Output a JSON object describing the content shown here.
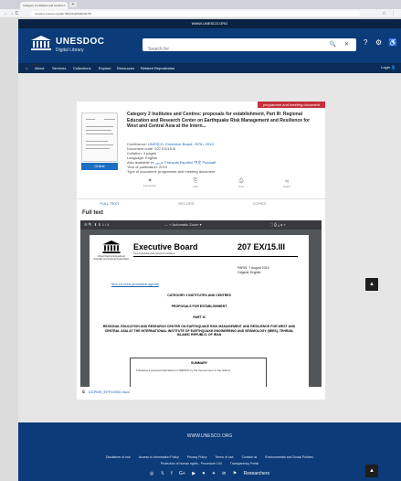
{
  "browser": {
    "tab_title": "Category 2 institutes and Centres",
    "tab_close": "×",
    "new_tab": "+",
    "nav_icons": "← → C",
    "url": "unesdoc.unesco.org/ark:/48223/pf0000230781",
    "right_icons": "☆ ⋮"
  },
  "site": {
    "top_strip": "WWW.UNESCO.ORG",
    "logo_title": "UNESDOC",
    "logo_subtitle": "Digital Library",
    "search_placeholder": "Search for",
    "search_icons": {
      "search": "🔍",
      "clear": "✕"
    },
    "header_icons": [
      "?",
      "⚙",
      "♿"
    ],
    "menu": [
      "About",
      "Services",
      "Collections",
      "Explore",
      "Resources",
      "Related Repositories"
    ],
    "login": "Login"
  },
  "breadcrumb": "⌂ > Notice",
  "record": {
    "badge": "programme and meeting document",
    "online_label": "Online",
    "title": "Category 2 Institutes and Centres: proposals for establishment, Part III: Regional Education and Research Center on Earthquake Risk Management and Resilience for West and Central Asia at the Intern...",
    "meta": [
      {
        "label": "Conference:",
        "value": "UNESCO. Executive Board, 207th, 2019"
      },
      {
        "label": "Document code:",
        "value": "207 EX/15.III"
      },
      {
        "label": "Collation:",
        "value": "4 pages"
      },
      {
        "label": "Language:",
        "value": "English"
      },
      {
        "label": "Also available in:",
        "value": "عربي  Français  Español  中文  Русский"
      },
      {
        "label": "Year of publication:",
        "value": "2019"
      },
      {
        "label": "Type of document:",
        "value": "programme and meeting document"
      }
    ],
    "actions": [
      "Favourites",
      "Add",
      "Print",
      "Share"
    ]
  },
  "tabs": [
    "FULL TEXT",
    "RECORD",
    "COPIES"
  ],
  "fulltext": {
    "title": "Full text",
    "pdf_toolbar": {
      "left": "☰  🔍  ⬆ ⬇  1 / 4",
      "zoom": "—  +  Automatic Zoom  ▾",
      "right": "⛶  ⎙  ⤓  ⚲  »"
    },
    "pdf": {
      "unesco_small": "United Nations Educational, Scientific and Cultural Organization",
      "board": "Executive Board",
      "board_sub": "Two hundred and seventh session",
      "code": "207 EX/15.III",
      "date_line1": "PARIS, 7 August 2019",
      "date_line2": "Original: English",
      "item": "Item 15 of the provisional agenda",
      "heading1": "CATEGORY 2 INSTITUTES AND CENTRES",
      "heading2": "PROPOSALS FOR ESTABLISHMENT",
      "heading3": "PART III",
      "heading4": "REGIONAL EDUCATION AND RESEARCH CENTER ON EARTHQUAKE RISK MANAGEMENT AND RESILIENCE FOR WEST AND CENTRAL ASIA AT THE INTERNATIONAL INSTITUTE OF EARTHQUAKE ENGINEERING AND SEISMOLOGY (IIEES), TEHRAN, ISLAMIC REPUBLIC OF IRAN",
      "summary_title": "SUMMARY",
      "summary_text": "Following a proposal submitted to UNESCO by the Government of the Islamic"
    },
    "download_label": "⧉",
    "download_file": "DCPMS_EFP10050.docx"
  },
  "scroll_up": "▲",
  "footer": {
    "site": "WWW.UNESCO.ORG",
    "links": [
      "Disclaimer of use",
      "Access to Information Policy",
      "Privacy Policy",
      "Terms of use",
      "Contact us",
      "Environmental and Social Policies"
    ],
    "links2": [
      "Protection of human rights - Procedure 104",
      "Transparency Portal"
    ],
    "social": [
      "◎",
      "𝕏",
      "f",
      "G+",
      "▶",
      "♥",
      "✦",
      "in",
      "⚑",
      "Researchers"
    ]
  }
}
